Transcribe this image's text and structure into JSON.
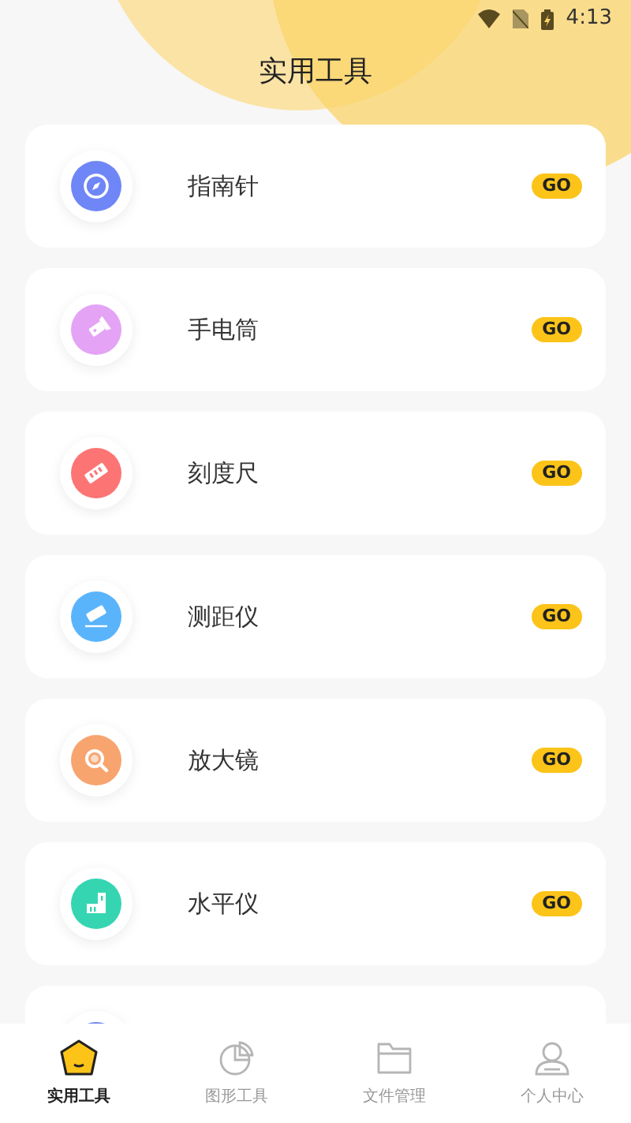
{
  "status_bar": {
    "time": "4:13"
  },
  "title": "实用工具",
  "tools": [
    {
      "kind": "tool",
      "label": "指南针",
      "color": "#6f86f6",
      "action": "GO"
    },
    {
      "kind": "tool",
      "label": "手电筒",
      "color": "#e4a3f5",
      "action": "GO"
    },
    {
      "kind": "tool",
      "label": "刻度尺",
      "color": "#fd7474",
      "action": "GO"
    },
    {
      "kind": "tool",
      "label": "测距仪",
      "color": "#5ab4fb",
      "action": "GO"
    },
    {
      "kind": "tool",
      "label": "放大镜",
      "color": "#f7a46f",
      "action": "GO"
    },
    {
      "kind": "tool",
      "label": "水平仪",
      "color": "#35d5b2",
      "action": "GO"
    },
    {
      "kind": "partial",
      "color": "#6f86f6"
    }
  ],
  "tabs": [
    {
      "label": "实用工具",
      "selected": true
    },
    {
      "label": "图形工具",
      "selected": false
    },
    {
      "label": "文件管理",
      "selected": false
    },
    {
      "label": "个人中心",
      "selected": false
    }
  ]
}
